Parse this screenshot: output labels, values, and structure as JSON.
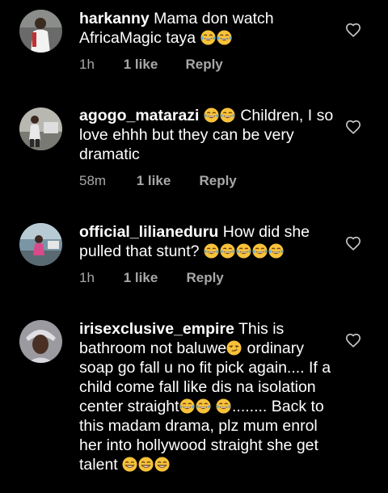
{
  "colors": {
    "background": "#000000",
    "text": "#ffffff",
    "meta": "#a8a8a8"
  },
  "comments": [
    {
      "username": "harkanny",
      "text_before": "Mama don watch AfricaMagic taya",
      "emojis_after": [
        "laugh",
        "laugh"
      ],
      "time": "1h",
      "likes": "1 like",
      "reply": "Reply",
      "heart_icon": "heart-outline-icon"
    },
    {
      "username": "agogo_matarazi",
      "emojis_before": [
        "laugh",
        "laugh"
      ],
      "text_after": "Children, I so love ehhh but they can be very dramatic",
      "time": "58m",
      "likes": "1 like",
      "reply": "Reply",
      "heart_icon": "heart-outline-icon"
    },
    {
      "username": "official_lilianeduru",
      "text_before": "How did she pulled that stunt?",
      "emojis_after": [
        "laugh",
        "laugh",
        "laugh",
        "laugh",
        "laugh"
      ],
      "time": "1h",
      "likes": "1 like",
      "reply": "Reply",
      "heart_icon": "heart-outline-icon"
    },
    {
      "username": "irisexclusive_empire",
      "part1": "This is bathroom not baluwe",
      "part2": " ordinary soap go fall u no fit pick again.... If a child come fall like dis na isolation center straight",
      "part3": "........ Back to this madam drama, plz mum enrol her into hollywood straight she get talent",
      "emojis_smirk": [
        "smirk"
      ],
      "emojis_mid": [
        "laugh",
        "laugh",
        "laugh"
      ],
      "emojis_end": [
        "grin",
        "grin",
        "grin"
      ],
      "heart_icon": "heart-outline-icon"
    }
  ]
}
